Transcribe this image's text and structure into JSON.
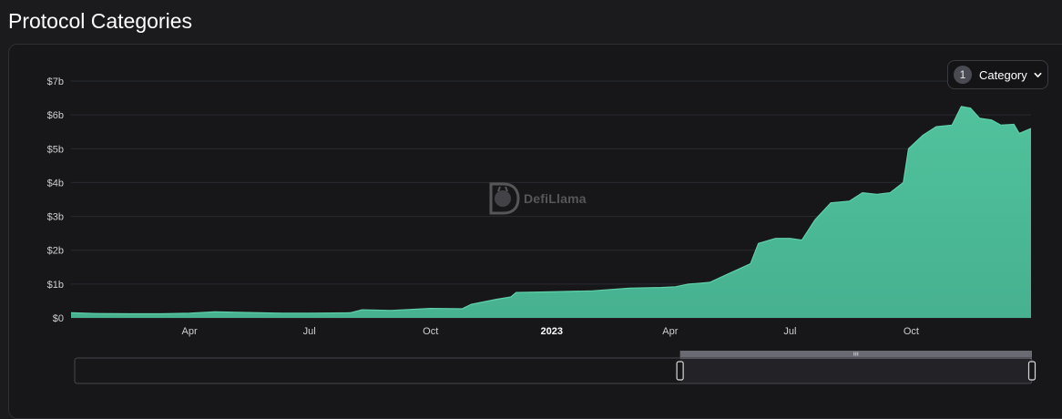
{
  "page": {
    "title": "Protocol Categories"
  },
  "selector": {
    "count": "1",
    "label": "Category"
  },
  "watermark": {
    "text": "DefiLlama"
  },
  "colors": {
    "area": "#4cb896",
    "area_top": "#5fd0a8",
    "background": "#1b1b1d",
    "grid": "#2a2b30"
  },
  "chart_data": {
    "type": "area",
    "y_ticks": [
      "$0",
      "$1b",
      "$2b",
      "$3b",
      "$4b",
      "$5b",
      "$6b",
      "$7b"
    ],
    "ylim": [
      0,
      7
    ],
    "yunit": "billion USD",
    "x_ticks": [
      {
        "label": "Apr",
        "date": "2022-04-01"
      },
      {
        "label": "Jul",
        "date": "2022-07-01"
      },
      {
        "label": "Oct",
        "date": "2022-10-01"
      },
      {
        "label": "2023",
        "date": "2023-01-01",
        "bold": true
      },
      {
        "label": "Apr",
        "date": "2023-04-01"
      },
      {
        "label": "Jul",
        "date": "2023-07-01"
      },
      {
        "label": "Oct",
        "date": "2023-10-01"
      }
    ],
    "xlim": [
      "2022-01-01",
      "2023-12-31"
    ],
    "grid": true,
    "series": [
      {
        "points": [
          [
            "2022-01-01",
            0.15
          ],
          [
            "2022-01-20",
            0.13
          ],
          [
            "2022-02-15",
            0.12
          ],
          [
            "2022-03-10",
            0.12
          ],
          [
            "2022-04-01",
            0.14
          ],
          [
            "2022-04-20",
            0.18
          ],
          [
            "2022-05-15",
            0.16
          ],
          [
            "2022-06-10",
            0.14
          ],
          [
            "2022-07-01",
            0.14
          ],
          [
            "2022-08-01",
            0.15
          ],
          [
            "2022-08-10",
            0.24
          ],
          [
            "2022-09-01",
            0.22
          ],
          [
            "2022-10-01",
            0.28
          ],
          [
            "2022-10-25",
            0.27
          ],
          [
            "2022-11-01",
            0.4
          ],
          [
            "2022-11-20",
            0.55
          ],
          [
            "2022-12-01",
            0.62
          ],
          [
            "2022-12-05",
            0.75
          ],
          [
            "2023-01-01",
            0.77
          ],
          [
            "2023-02-01",
            0.8
          ],
          [
            "2023-03-01",
            0.88
          ],
          [
            "2023-03-25",
            0.9
          ],
          [
            "2023-04-05",
            0.92
          ],
          [
            "2023-04-15",
            1.0
          ],
          [
            "2023-05-01",
            1.05
          ],
          [
            "2023-05-15",
            1.3
          ],
          [
            "2023-06-01",
            1.6
          ],
          [
            "2023-06-07",
            2.2
          ],
          [
            "2023-06-20",
            2.35
          ],
          [
            "2023-07-01",
            2.35
          ],
          [
            "2023-07-10",
            2.3
          ],
          [
            "2023-07-20",
            2.9
          ],
          [
            "2023-08-01",
            3.4
          ],
          [
            "2023-08-15",
            3.45
          ],
          [
            "2023-08-25",
            3.7
          ],
          [
            "2023-09-05",
            3.65
          ],
          [
            "2023-09-15",
            3.7
          ],
          [
            "2023-09-25",
            4.0
          ],
          [
            "2023-09-29",
            5.0
          ],
          [
            "2023-10-10",
            5.4
          ],
          [
            "2023-10-20",
            5.65
          ],
          [
            "2023-11-01",
            5.7
          ],
          [
            "2023-11-08",
            6.25
          ],
          [
            "2023-11-15",
            6.2
          ],
          [
            "2023-11-22",
            5.9
          ],
          [
            "2023-12-01",
            5.85
          ],
          [
            "2023-12-08",
            5.7
          ],
          [
            "2023-12-18",
            5.72
          ],
          [
            "2023-12-22",
            5.45
          ],
          [
            "2023-12-31",
            5.6
          ]
        ]
      }
    ],
    "zoom_range": {
      "start": "2023-04-07",
      "end": "2023-12-31"
    }
  }
}
